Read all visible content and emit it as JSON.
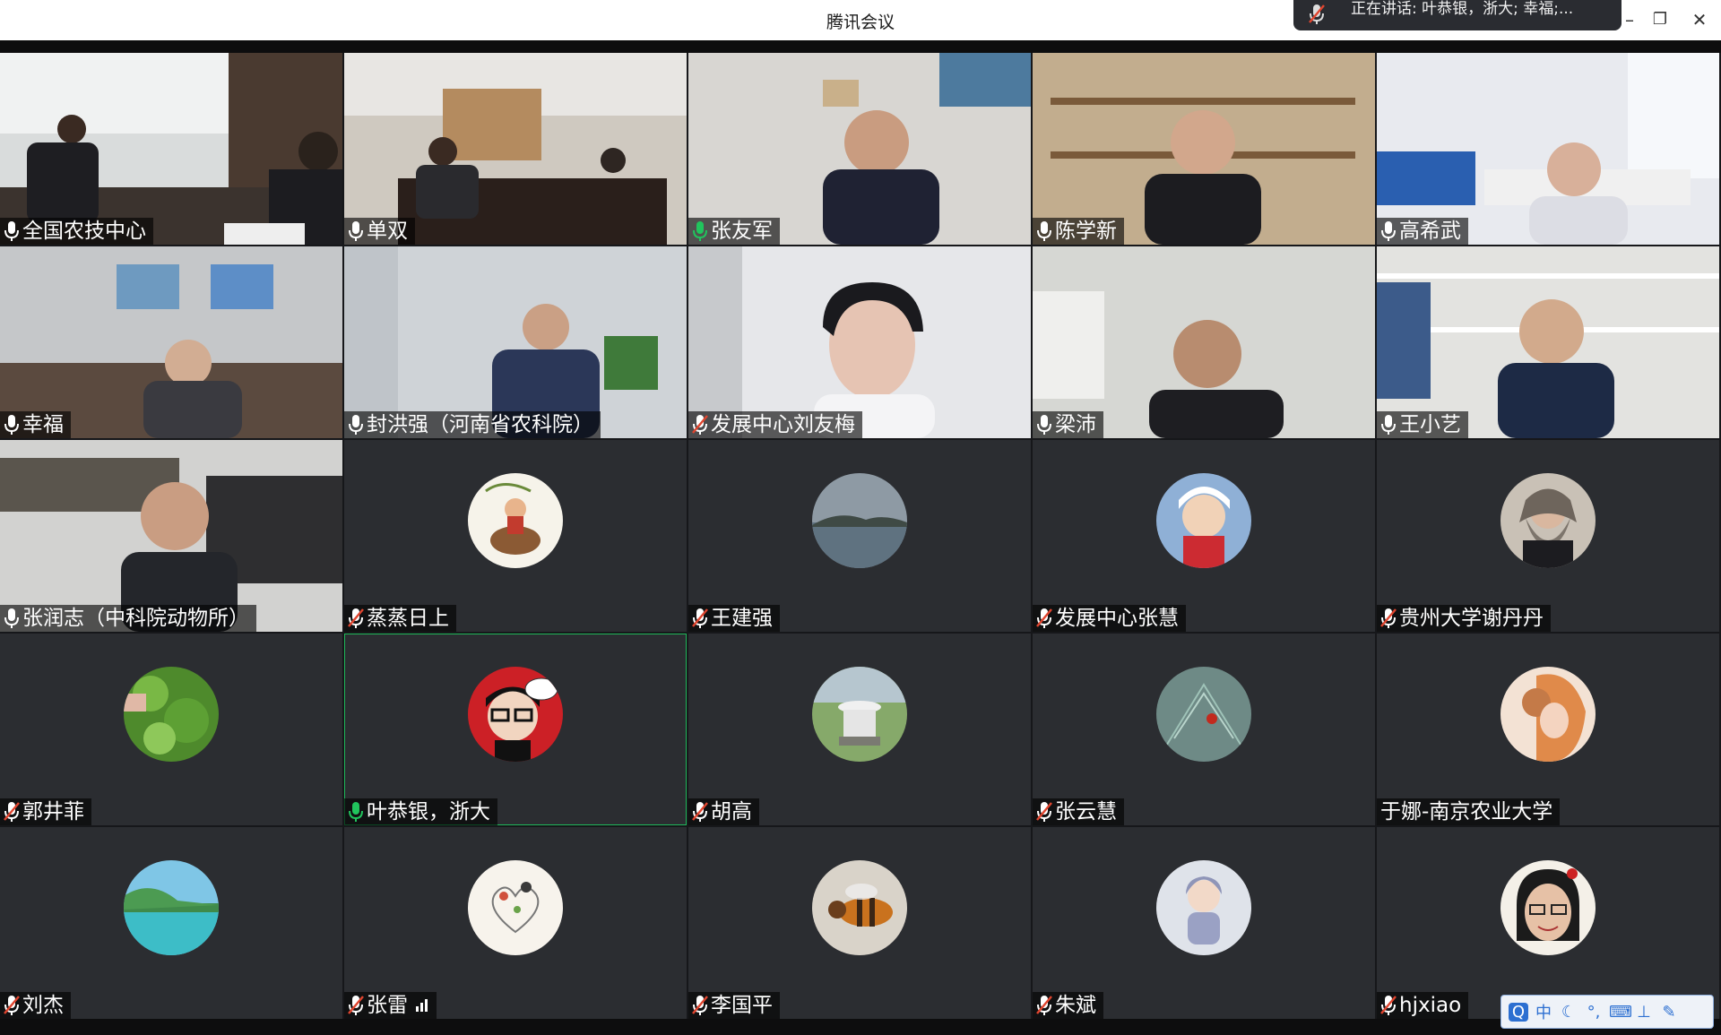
{
  "window": {
    "title": "腾讯会议",
    "min_label": "–",
    "restore_label": "❐",
    "close_label": "✕"
  },
  "speaking": {
    "text": "正在讲话: 叶恭银，浙大; 幸福;..."
  },
  "participants": [
    {
      "name": "全国农技中心",
      "mic": "on",
      "video": true
    },
    {
      "name": "单双",
      "mic": "on",
      "video": true
    },
    {
      "name": "张友军",
      "mic": "speaking",
      "video": true
    },
    {
      "name": "陈学新",
      "mic": "on",
      "video": true
    },
    {
      "name": "高希武",
      "mic": "on",
      "video": true
    },
    {
      "name": "幸福",
      "mic": "on",
      "video": true
    },
    {
      "name": "封洪强（河南省农科院）",
      "mic": "on",
      "video": true
    },
    {
      "name": "发展中心刘友梅",
      "mic": "muted",
      "video": true
    },
    {
      "name": "梁沛",
      "mic": "on",
      "video": true
    },
    {
      "name": "王小艺",
      "mic": "on",
      "video": true
    },
    {
      "name": "张润志（中科院动物所）",
      "mic": "on",
      "video": true
    },
    {
      "name": "蒸蒸日上",
      "mic": "muted",
      "video": false,
      "avatar": "cartoon-rider"
    },
    {
      "name": "王建强",
      "mic": "muted",
      "video": false,
      "avatar": "lake"
    },
    {
      "name": "发展中心张慧",
      "mic": "muted",
      "video": false,
      "avatar": "anime-boy"
    },
    {
      "name": "贵州大学谢丹丹",
      "mic": "muted",
      "video": false,
      "avatar": "bearded-man"
    },
    {
      "name": "郭井菲",
      "mic": "muted",
      "video": false,
      "avatar": "green-leaves"
    },
    {
      "name": "叶恭银，浙大",
      "mic": "speaking",
      "video": false,
      "avatar": "cartoon-glasses",
      "active": true
    },
    {
      "name": "胡高",
      "mic": "muted",
      "video": false,
      "avatar": "radar-field"
    },
    {
      "name": "张云慧",
      "mic": "muted",
      "video": false,
      "avatar": "ladybug-pine"
    },
    {
      "name": "于娜-南京农业大学",
      "mic": "none",
      "video": false,
      "avatar": "girl-cat"
    },
    {
      "name": "刘杰",
      "mic": "muted",
      "video": false,
      "avatar": "tropical-island"
    },
    {
      "name": "张雷",
      "mic": "muted",
      "video": false,
      "avatar": "heart-doodle",
      "signal": true
    },
    {
      "name": "李国平",
      "mic": "muted",
      "video": false,
      "avatar": "bee"
    },
    {
      "name": "朱斌",
      "mic": "muted",
      "video": false,
      "avatar": "baby"
    },
    {
      "name": "hjxiao",
      "mic": "muted",
      "video": false,
      "avatar": "smiling-girl"
    }
  ],
  "ime": {
    "lang": "中"
  },
  "colors": {
    "mic_on": "#ffffff",
    "mic_speaking": "#21c45d",
    "mic_muted": "#e0452f",
    "tile_bg": "#2b2d31",
    "active_border": "#1fb85a"
  }
}
